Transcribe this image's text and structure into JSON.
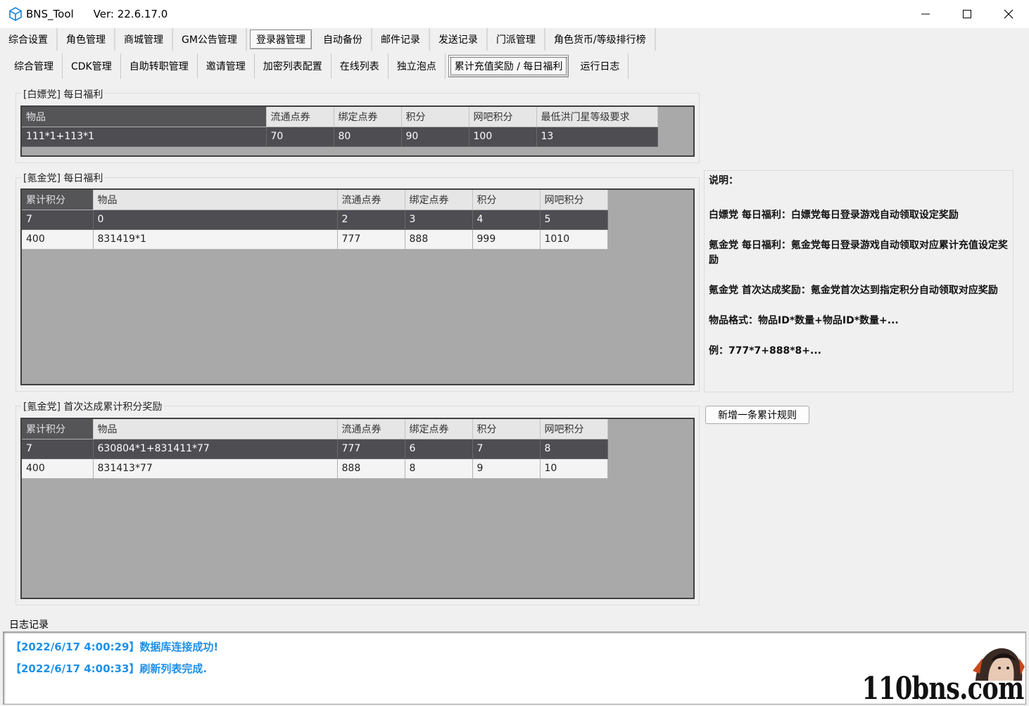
{
  "window": {
    "title": "BNS_Tool",
    "version": "Ver:  22.6.17.0"
  },
  "main_tabs": [
    {
      "label": "综合设置"
    },
    {
      "label": "角色管理"
    },
    {
      "label": "商城管理"
    },
    {
      "label": "GM公告管理"
    },
    {
      "label": "登录器管理",
      "active": true
    },
    {
      "label": "自动备份"
    },
    {
      "label": "邮件记录"
    },
    {
      "label": "发送记录"
    },
    {
      "label": "门派管理"
    },
    {
      "label": "角色货币/等级排行榜"
    }
  ],
  "sub_tabs": [
    {
      "label": "综合管理"
    },
    {
      "label": "CDK管理"
    },
    {
      "label": "自助转职管理"
    },
    {
      "label": "邀请管理"
    },
    {
      "label": "加密列表配置"
    },
    {
      "label": "在线列表"
    },
    {
      "label": "独立泡点"
    },
    {
      "label": "累计充值奖励 / 每日福利",
      "active": true
    },
    {
      "label": "运行日志"
    }
  ],
  "free_daily": {
    "group_label": "[白嫖党] 每日福利",
    "columns": [
      "物品",
      "流通点券",
      "绑定点券",
      "积分",
      "网吧积分",
      "最低洪门星等级要求"
    ],
    "rows": [
      [
        "111*1+113*1",
        "70",
        "80",
        "90",
        "100",
        "13"
      ]
    ]
  },
  "paid_daily": {
    "group_label": "[氪金党] 每日福利",
    "columns": [
      "累计积分",
      "物品",
      "流通点券",
      "绑定点券",
      "积分",
      "网吧积分"
    ],
    "rows": [
      [
        "7",
        "0",
        "2",
        "3",
        "4",
        "5"
      ],
      [
        "400",
        "831419*1",
        "777",
        "888",
        "999",
        "1010"
      ]
    ]
  },
  "paid_first": {
    "group_label": "[氪金党] 首次达成累计积分奖励",
    "columns": [
      "累计积分",
      "物品",
      "流通点券",
      "绑定点券",
      "积分",
      "网吧积分"
    ],
    "rows": [
      [
        "7",
        "630804*1+831411*77",
        "777",
        "6",
        "7",
        "8"
      ],
      [
        "400",
        "831413*77",
        "888",
        "8",
        "9",
        "10"
      ]
    ]
  },
  "explain": {
    "title": "说明：",
    "lines": [
      "白嫖党 每日福利：白嫖党每日登录游戏自动领取设定奖励",
      "氪金党 每日福利：氪金党每日登录游戏自动领取对应累计充值设定奖励",
      "氪金党 首次达成奖励：氪金党首次达到指定积分自动领取对应奖励",
      "物品格式：物品ID*数量+物品ID*数量+...",
      "例：777*7+888*8+..."
    ]
  },
  "add_button": "新增一条累计规则",
  "log": {
    "label": "日志记录",
    "lines": [
      "【2022/6/17 4:00:29】数据库连接成功!",
      "【2022/6/17 4:00:33】刷新列表完成."
    ]
  },
  "watermark": "110bns.com"
}
